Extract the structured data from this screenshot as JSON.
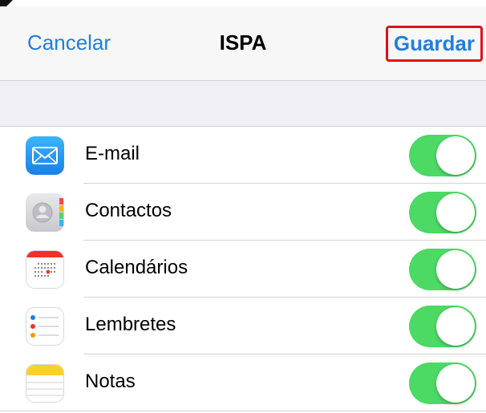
{
  "nav": {
    "cancel_label": "Cancelar",
    "title": "ISPA",
    "save_label": "Guardar"
  },
  "rows": [
    {
      "label": "E-mail",
      "icon": "mail-icon",
      "enabled": true
    },
    {
      "label": "Contactos",
      "icon": "contacts-icon",
      "enabled": true
    },
    {
      "label": "Calendários",
      "icon": "calendar-icon",
      "enabled": true
    },
    {
      "label": "Lembretes",
      "icon": "reminders-icon",
      "enabled": true
    },
    {
      "label": "Notas",
      "icon": "notes-icon",
      "enabled": true
    }
  ],
  "colors": {
    "accent": "#1f7fe0",
    "toggle_on": "#4cd964",
    "highlight": "#e0101b"
  }
}
